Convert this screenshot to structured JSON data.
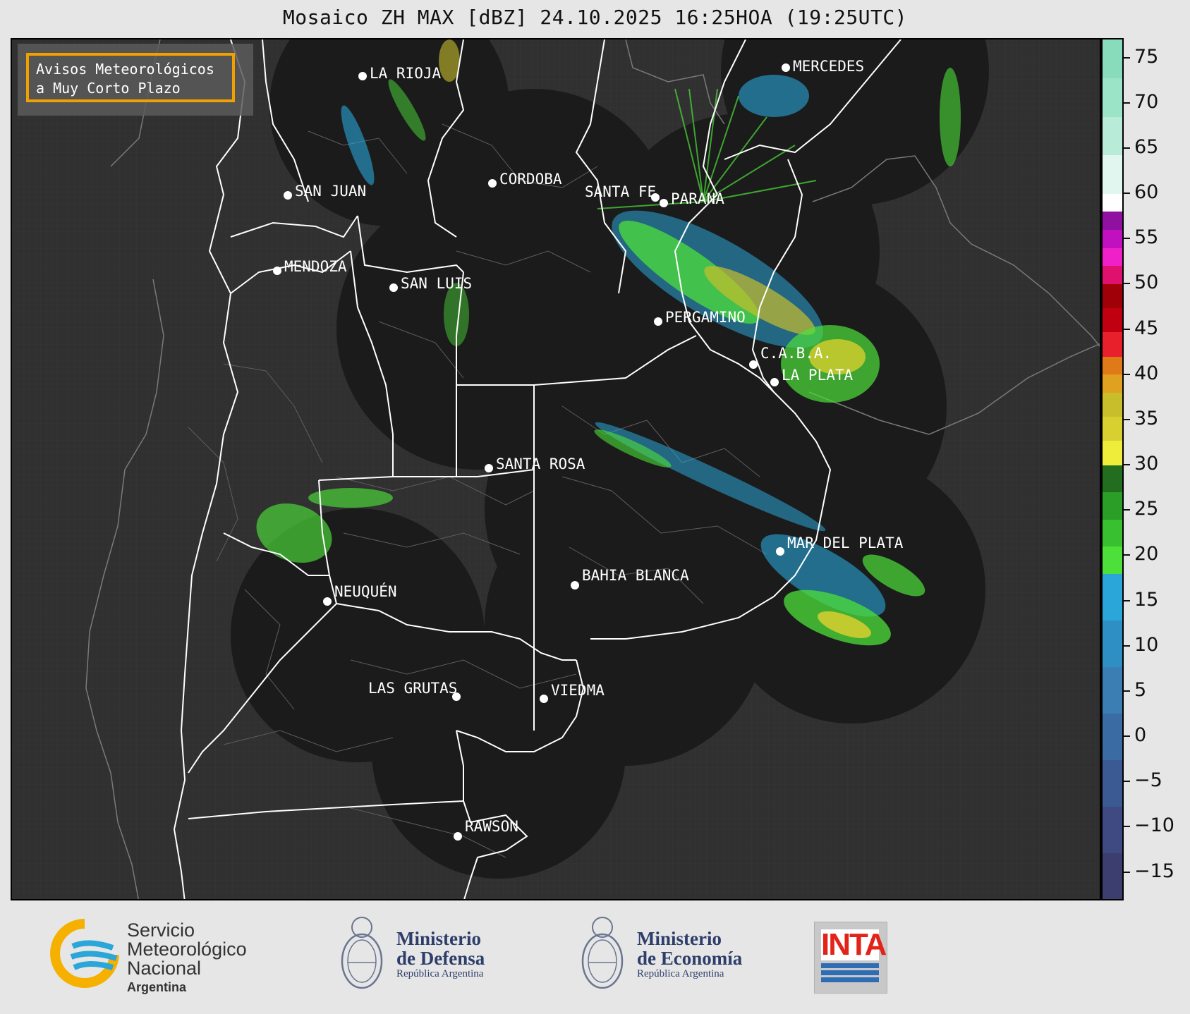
{
  "title": "Mosaico ZH MAX [dBZ] 24.10.2025 16:25HOA (19:25UTC)",
  "notice": {
    "line1": "Avisos Meteorológicos",
    "line2": "a Muy Corto Plazo"
  },
  "cities": [
    {
      "name": "LA RIOJA",
      "key": "la-rioja"
    },
    {
      "name": "MERCEDES",
      "key": "mercedes"
    },
    {
      "name": "CORDOBA",
      "key": "cordoba"
    },
    {
      "name": "SAN JUAN",
      "key": "san-juan"
    },
    {
      "name": "SANTA FE",
      "key": "santa-fe"
    },
    {
      "name": "PARANA",
      "key": "parana"
    },
    {
      "name": "MENDOZA",
      "key": "mendoza"
    },
    {
      "name": "SAN LUIS",
      "key": "san-luis"
    },
    {
      "name": "PERGAMINO",
      "key": "pergamino"
    },
    {
      "name": "C.A.B.A.",
      "key": "caba"
    },
    {
      "name": "LA PLATA",
      "key": "la-plata"
    },
    {
      "name": "SANTA ROSA",
      "key": "santa-rosa"
    },
    {
      "name": "MAR DEL PLATA",
      "key": "mar-del-plata"
    },
    {
      "name": "BAHIA BLANCA",
      "key": "bahia-blanca"
    },
    {
      "name": "NEUQUÉN",
      "key": "neuquen"
    },
    {
      "name": "LAS GRUTAS",
      "key": "las-grutas"
    },
    {
      "name": "VIEDMA",
      "key": "viedma"
    },
    {
      "name": "RAWSON",
      "key": "rawson"
    }
  ],
  "colorbar": {
    "min": -18,
    "max": 77,
    "ticks": [
      "75",
      "70",
      "65",
      "60",
      "55",
      "50",
      "45",
      "40",
      "35",
      "30",
      "25",
      "20",
      "15",
      "10",
      "5",
      "0",
      "−5",
      "−10",
      "−15"
    ],
    "tick_values": [
      75,
      70,
      65,
      60,
      55,
      50,
      45,
      40,
      35,
      30,
      25,
      20,
      15,
      10,
      5,
      0,
      -5,
      -10,
      -15
    ],
    "colors": [
      {
        "from": -18,
        "to": 18,
        "stops": [
          "#3b3e6e",
          "#3f4a82",
          "#3b5a94",
          "#3a6ca3",
          "#3a7eb3",
          "#2e8fc4",
          "#2aa6d8"
        ]
      },
      {
        "from": 18,
        "to": 30,
        "stops": [
          "#4de03a",
          "#38c030",
          "#2a9e26",
          "#226e1e"
        ]
      },
      {
        "from": 30,
        "to": 38,
        "stops": [
          "#f0ec3a",
          "#d8d030",
          "#c8be2c"
        ]
      },
      {
        "from": 38,
        "to": 42,
        "stops": [
          "#e0a020",
          "#e07a18"
        ]
      },
      {
        "from": 42,
        "to": 50,
        "stops": [
          "#e8202c",
          "#c00010",
          "#a00008"
        ]
      },
      {
        "from": 50,
        "to": 58,
        "stops": [
          "#e0106e",
          "#f020c8",
          "#c010c0",
          "#9010a0"
        ]
      },
      {
        "from": 58,
        "to": 60,
        "stops": [
          "#ffffff"
        ]
      },
      {
        "from": 60,
        "to": 77,
        "stops": [
          "#e0f6ee",
          "#b8ecd8",
          "#9ce4c8",
          "#88dcbc"
        ]
      }
    ]
  },
  "footer": {
    "smn": {
      "line1": "Servicio",
      "line2": "Meteorológico",
      "line3": "Nacional",
      "line4": "Argentina"
    },
    "defensa": {
      "line1": "Ministerio",
      "line2": "de Defensa",
      "line3": "República Argentina"
    },
    "economia": {
      "line1": "Ministerio",
      "line2": "de Economía",
      "line3": "República Argentina"
    },
    "inta": {
      "label": "INTA"
    }
  }
}
